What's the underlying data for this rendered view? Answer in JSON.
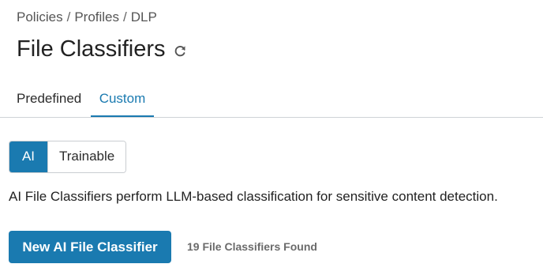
{
  "breadcrumb": {
    "items": [
      "Policies",
      "Profiles",
      "DLP"
    ],
    "separator": "/"
  },
  "header": {
    "title": "File Classifiers",
    "refresh_icon": "refresh-icon"
  },
  "tabs": [
    {
      "label": "Predefined",
      "active": false
    },
    {
      "label": "Custom",
      "active": true
    }
  ],
  "classifier_type": {
    "options": [
      {
        "label": "AI",
        "active": true
      },
      {
        "label": "Trainable",
        "active": false
      }
    ]
  },
  "description": "AI File Classifiers perform LLM-based classification for sensitive content detection.",
  "actions": {
    "new_button_label": "New AI File Classifier"
  },
  "results": {
    "count_text": "19 File Classifiers Found"
  },
  "colors": {
    "accent": "#1a7ab0",
    "text": "#2b2b2b",
    "muted": "#6b6b6b",
    "divider": "#cfd3d7"
  }
}
